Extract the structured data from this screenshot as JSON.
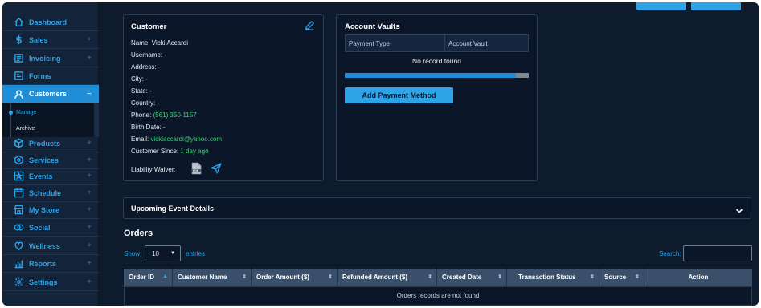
{
  "sidebar": {
    "items": [
      {
        "label": "Dashboard",
        "icon": "home-icon",
        "expandable": false
      },
      {
        "label": "Sales",
        "icon": "dollar-icon",
        "expandable": true
      },
      {
        "label": "Invoicing",
        "icon": "invoice-icon",
        "expandable": true
      },
      {
        "label": "Forms",
        "icon": "form-icon",
        "expandable": false
      },
      {
        "label": "Customers",
        "icon": "user-icon",
        "expandable": true,
        "active": true,
        "expand_symbol": "−"
      },
      {
        "label": "Products",
        "icon": "box-icon",
        "expandable": true
      },
      {
        "label": "Services",
        "icon": "services-icon",
        "expandable": true
      },
      {
        "label": "Events",
        "icon": "star-icon",
        "expandable": true
      },
      {
        "label": "Schedule",
        "icon": "calendar-icon",
        "expandable": true
      },
      {
        "label": "My Store",
        "icon": "store-icon",
        "expandable": true
      },
      {
        "label": "Social",
        "icon": "social-icon",
        "expandable": true
      },
      {
        "label": "Wellness",
        "icon": "wellness-icon",
        "expandable": true
      },
      {
        "label": "Reports",
        "icon": "reports-icon",
        "expandable": true
      },
      {
        "label": "Settings",
        "icon": "gear-icon",
        "expandable": true
      }
    ],
    "plus_symbol": "+",
    "customers_submenu": [
      {
        "label": "Manage",
        "active": true
      },
      {
        "label": "Archive",
        "active": false
      }
    ]
  },
  "customer": {
    "title": "Customer",
    "name_label": "Name:",
    "name_value": "Vicki Accardi",
    "username_label": "Username:",
    "username_value": "-",
    "address_label": "Address:",
    "address_value": "-",
    "city_label": "City:",
    "city_value": "-",
    "state_label": "State:",
    "state_value": "-",
    "country_label": "Country:",
    "country_value": "-",
    "phone_label": "Phone:",
    "phone_value": "(561) 350-1157",
    "birth_label": "Birth Date:",
    "birth_value": "-",
    "email_label": "Email:",
    "email_value": "vickiaccardi@yahoo.com",
    "since_label": "Customer Since:",
    "since_value": "1 day ago",
    "waiver_label": "Liability Waiver:",
    "pdf_label": "PDF"
  },
  "vaults": {
    "title": "Account Vaults",
    "col_payment_type": "Payment Type",
    "col_account_vault": "Account Vault",
    "empty_text": "No record found",
    "progress_fraction": 0.93,
    "add_button": "Add Payment Method"
  },
  "upcoming": {
    "title": "Upcoming Event Details"
  },
  "orders": {
    "title": "Orders",
    "show_label": "Show",
    "page_size": "10",
    "entries_label": "entries",
    "search_label": "Search:",
    "columns": [
      "Order ID",
      "Customer Name",
      "Order Amount ($)",
      "Refunded Amount ($)",
      "Created Date",
      "Transaction Status",
      "Source",
      "Action"
    ],
    "empty_text": "Orders records are not found"
  },
  "colors": {
    "accent": "#2ea3e6",
    "active_nav": "#1f8ed6",
    "green_text": "#3fd07a",
    "background": "#0e1b2d",
    "card": "#0b1628"
  }
}
